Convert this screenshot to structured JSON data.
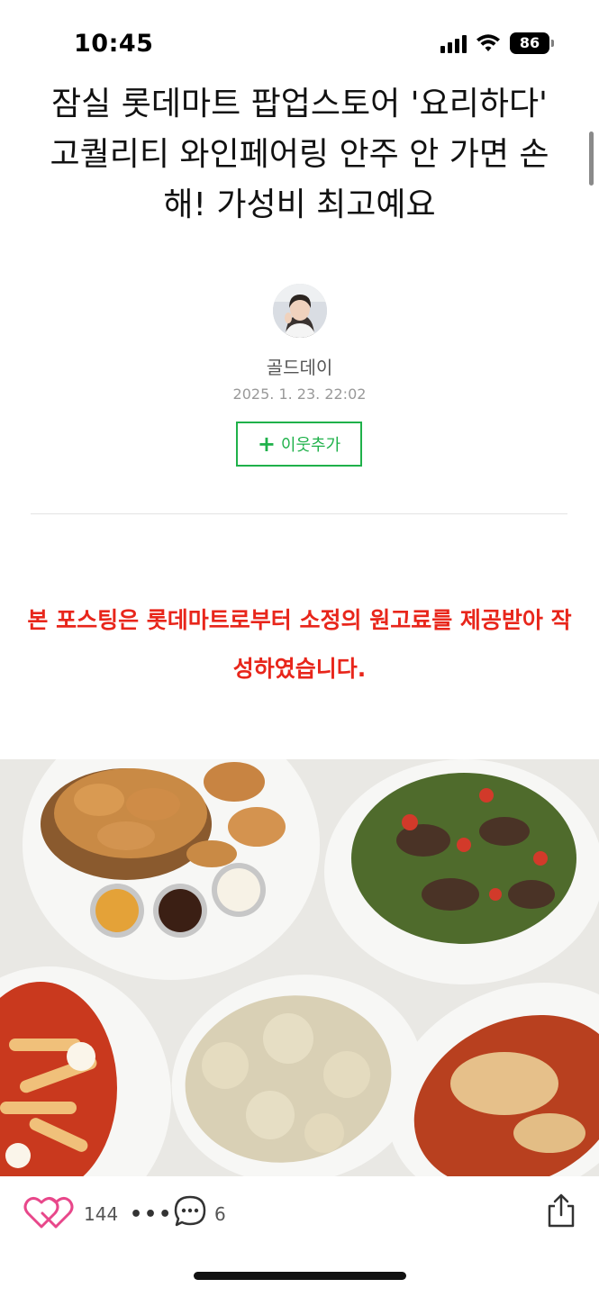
{
  "status_bar": {
    "time": "10:45",
    "battery": "86",
    "icons": [
      "cellular-signal-icon",
      "wifi-icon",
      "battery-icon"
    ]
  },
  "post": {
    "title": "잠실 롯데마트 팝업스토어 '요리하다' 고퀄리티 와인페어링 안주 안 가면 손해! 가성비 최고예요",
    "author": "골드데이",
    "date": "2025. 1. 23. 22:02",
    "follow_label": "이웃추가",
    "notice": "본 포스팅은 롯데마트로부터 소정의 원고료를 제공받아 작성하였습니다."
  },
  "bottom_bar": {
    "like_count": "144",
    "more_label": "•••",
    "comment_count": "6",
    "icons": [
      "heart-icon",
      "comment-icon",
      "share-icon"
    ]
  },
  "colors": {
    "accent_green": "#1fb14a",
    "notice_red": "#e8261b",
    "heart_pink": "#e8478a"
  }
}
